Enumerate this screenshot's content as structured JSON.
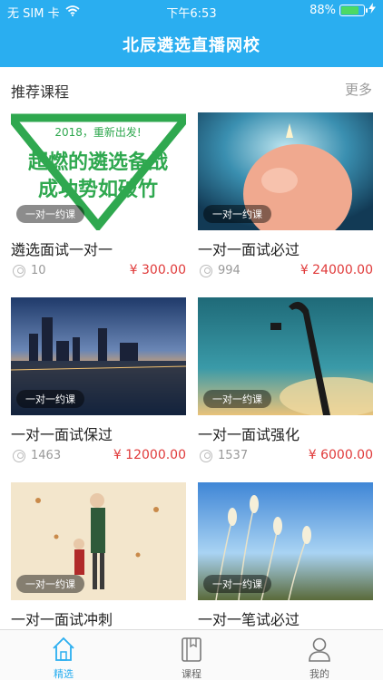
{
  "status_bar": {
    "carrier": "无 SIM 卡",
    "time": "下午6:53",
    "battery_percent": "88%",
    "battery_level": 0.88,
    "icons": [
      "wifi-icon",
      "battery-icon",
      "charging-icon"
    ]
  },
  "header": {
    "title": "北辰遴选直播网校"
  },
  "section": {
    "title": "推荐课程",
    "more": "更多"
  },
  "courses": [
    {
      "name": "遴选面试一对一",
      "tag": "一对一约课",
      "students": "10",
      "price": "¥ 300.00",
      "poster": {
        "line1": "2018，重新出发!",
        "line2": "超燃的遴选备战",
        "line3": "成功势如破竹"
      }
    },
    {
      "name": "一对一面试必过",
      "tag": "一对一约课",
      "students": "994",
      "price": "¥ 24000.00"
    },
    {
      "name": "一对一面试保过",
      "tag": "一对一约课",
      "students": "1463",
      "price": "¥ 12000.00"
    },
    {
      "name": "一对一面试强化",
      "tag": "一对一约课",
      "students": "1537",
      "price": "¥ 6000.00"
    },
    {
      "name": "一对一面试冲刺",
      "tag": "一对一约课"
    },
    {
      "name": "一对一笔试必过",
      "tag": "一对一约课"
    }
  ],
  "tabbar": {
    "items": [
      {
        "label": "精选",
        "icon": "home-icon",
        "active": true
      },
      {
        "label": "课程",
        "icon": "book-icon",
        "active": false
      },
      {
        "label": "我的",
        "icon": "user-icon",
        "active": false
      }
    ]
  },
  "colors": {
    "primary": "#2aaef0",
    "price": "#e03a3a",
    "poster_green": "#2fa84f"
  }
}
